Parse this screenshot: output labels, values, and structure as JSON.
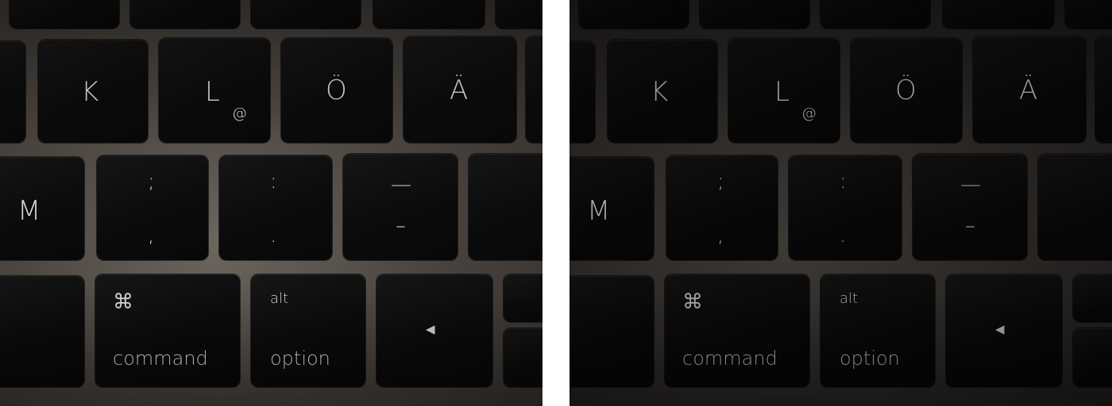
{
  "left_photo": {
    "keys": {
      "k": "K",
      "l": "L",
      "l_alt": "@",
      "o_umlaut": "Ö",
      "a_umlaut": "Ä",
      "m": "M",
      "semicolon_top": ";",
      "semicolon_bottom": ",",
      "colon_top": ":",
      "colon_bottom": ".",
      "underscore_top": "—",
      "underscore_bottom": "–",
      "command_symbol": "⌘",
      "command_label": "command",
      "option_alt": "alt",
      "option_label": "option",
      "arrow_left": "◀"
    }
  },
  "right_photo": {
    "keys": {
      "k": "K",
      "l": "L",
      "l_alt": "@",
      "o_umlaut": "Ö",
      "a_umlaut": "Ä",
      "m": "M",
      "semicolon_top": ";",
      "semicolon_bottom": ",",
      "colon_top": ":",
      "colon_bottom": ".",
      "underscore_top": "—",
      "underscore_bottom": "–",
      "command_symbol": "⌘",
      "command_label": "command",
      "option_alt": "alt",
      "option_label": "option",
      "arrow_left": "◀"
    }
  }
}
